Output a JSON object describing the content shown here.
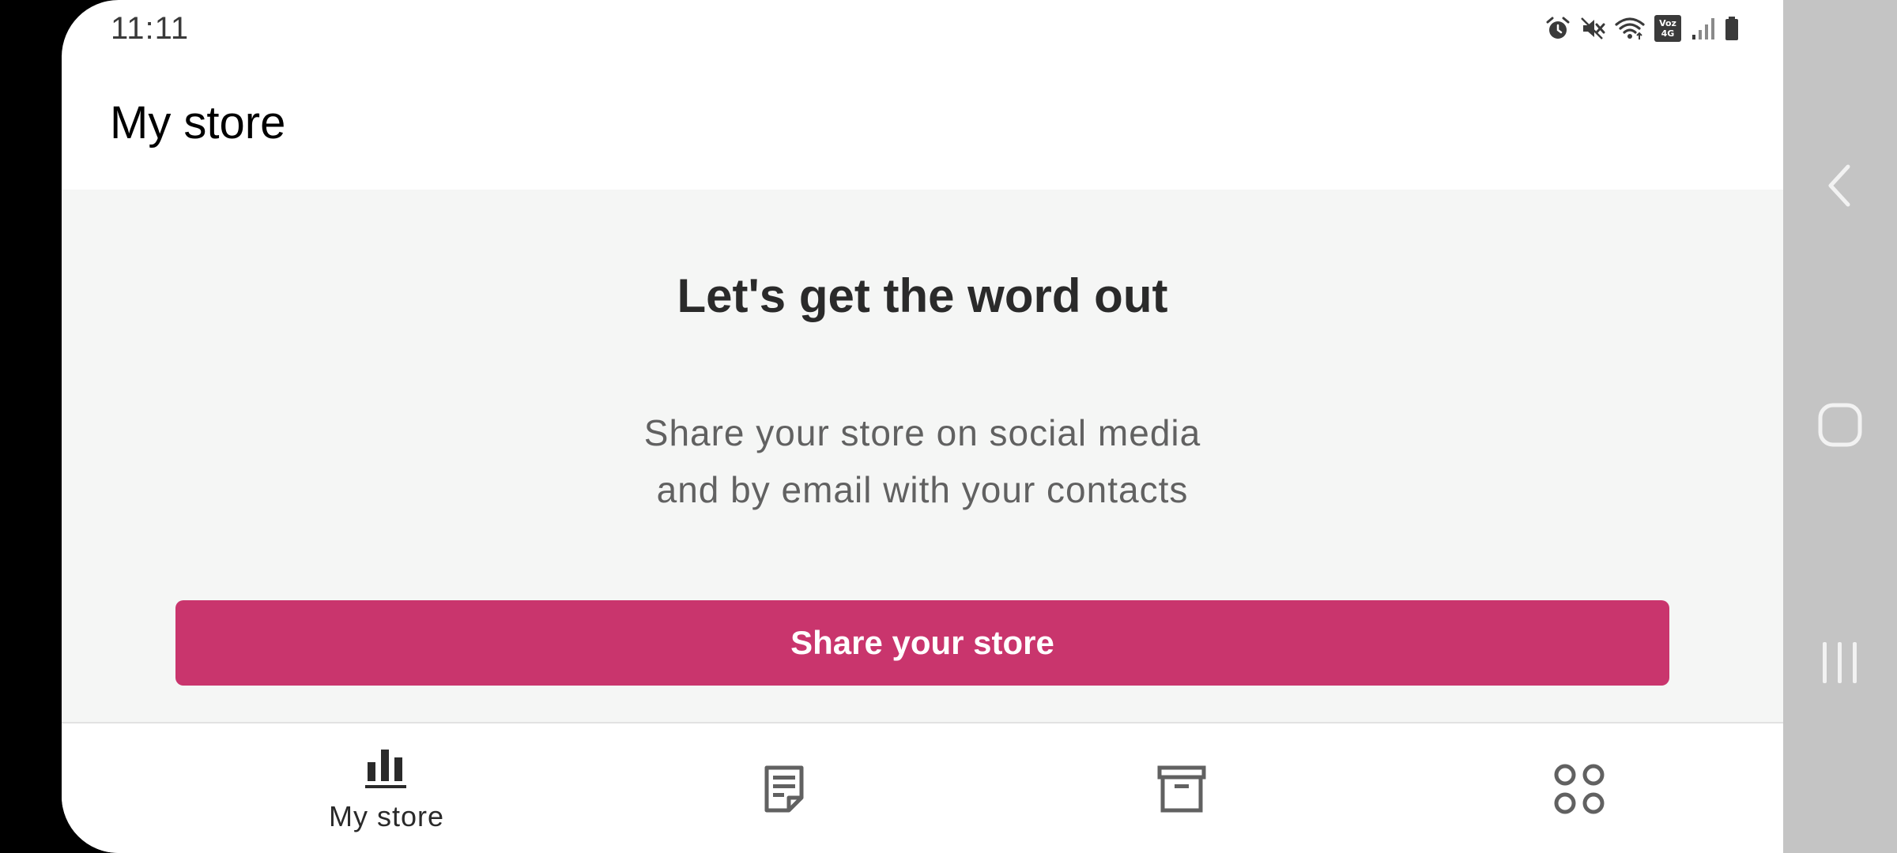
{
  "status_bar": {
    "time": "11:11",
    "icons": [
      "alarm-icon",
      "mute-icon",
      "wifi-icon",
      "volte-4g-icon",
      "signal-icon",
      "battery-icon"
    ],
    "lte_top": "Voz",
    "lte_bottom": "4G"
  },
  "app_bar": {
    "title": "My store"
  },
  "promo": {
    "title": "Let's get the word out",
    "line1": "Share your store on social media",
    "line2": "and by email with your contacts",
    "button_label": "Share your store",
    "button_color": "#c9356d"
  },
  "bottom_nav": {
    "items": [
      {
        "label": "My store",
        "icon": "bar-chart-icon",
        "selected": true
      },
      {
        "label": "",
        "icon": "orders-note-icon",
        "selected": false
      },
      {
        "label": "",
        "icon": "products-archive-icon",
        "selected": false
      },
      {
        "label": "",
        "icon": "menu-grid-icon",
        "selected": false
      }
    ]
  },
  "system_nav": {
    "buttons": [
      "back-icon",
      "home-icon",
      "recents-icon"
    ]
  }
}
